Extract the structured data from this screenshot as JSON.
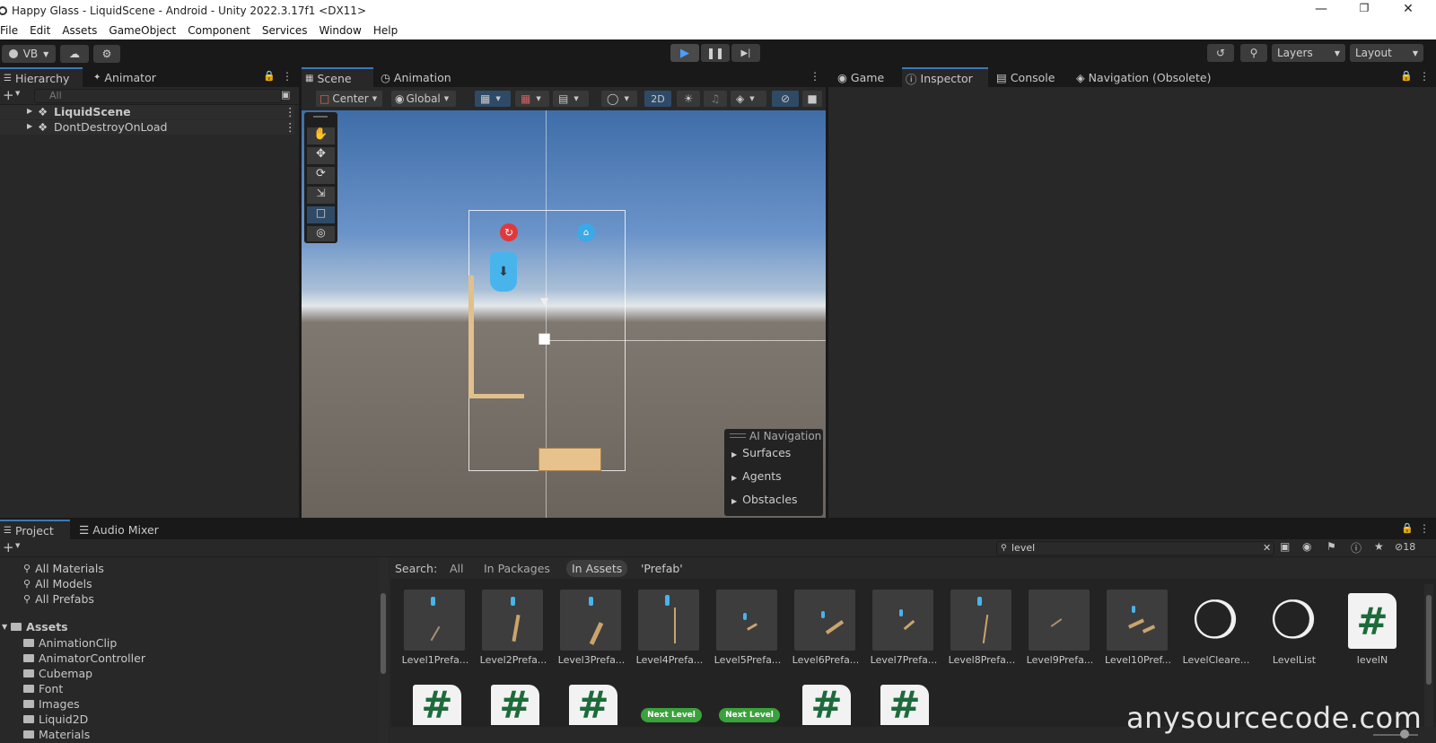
{
  "window": {
    "title": "Happy Glass - LiquidScene - Android - Unity 2022.3.17f1 <DX11>",
    "minimize_icon": "minimize-icon",
    "maximize_icon": "restore-icon",
    "close_icon": "close-icon"
  },
  "menu": [
    "File",
    "Edit",
    "Assets",
    "GameObject",
    "Component",
    "Services",
    "Window",
    "Help"
  ],
  "toolbar": {
    "account": "VB",
    "layers": "Layers",
    "layout": "Layout"
  },
  "hierarchy": {
    "tabs": [
      "Hierarchy",
      "Animator"
    ],
    "search_placeholder": "All",
    "items": [
      "LiquidScene",
      "DontDestroyOnLoad"
    ]
  },
  "scene": {
    "tabs": [
      "Scene",
      "Animation"
    ],
    "pivot": "Center",
    "space": "Global",
    "mode_2d": "2D",
    "overlay": {
      "title": "AI Navigation",
      "items": [
        "Surfaces",
        "Agents",
        "Obstacles"
      ]
    }
  },
  "right": {
    "tabs": [
      "Game",
      "Inspector",
      "Console",
      "Navigation (Obsolete)"
    ]
  },
  "project": {
    "tabs": [
      "Project",
      "Audio Mixer"
    ],
    "search_value": "level",
    "hidden_count": "18",
    "favorites": [
      "All Materials",
      "All Models",
      "All Prefabs"
    ],
    "assets_root": "Assets",
    "folders": [
      "AnimationClip",
      "AnimatorController",
      "Cubemap",
      "Font",
      "Images",
      "Liquid2D",
      "Materials"
    ],
    "search_label": "Search:",
    "filters": [
      "All",
      "In Packages",
      "In Assets",
      "'Prefab'"
    ],
    "assets_row1": [
      "Level1Prefa...",
      "Level2Prefa...",
      "Level3Prefa...",
      "Level4Prefa...",
      "Level5Prefa...",
      "Level6Prefa...",
      "Level7Prefa...",
      "Level8Prefa...",
      "Level9Prefa...",
      "Level10Pref...",
      "LevelCleare...",
      "LevelList",
      "levelN"
    ],
    "next_level_label": "Next Level"
  },
  "watermark": "anysourcecode.com"
}
